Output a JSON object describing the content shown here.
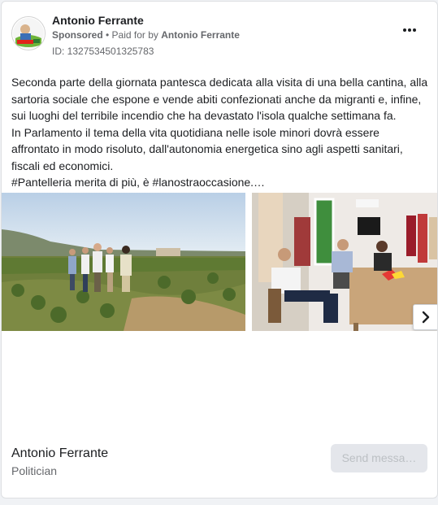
{
  "ad": {
    "page_name": "Antonio Ferrante",
    "sponsored_label": "Sponsored",
    "paid_for_prefix": " • Paid for by ",
    "paid_for_name": "Antonio Ferrante",
    "id_label": "ID: 1327534501325783",
    "more_icon": "more-horizontal-icon",
    "body_lines": [
      "Seconda parte della giornata pantesca dedicata alla visita di una bella cantina, alla sartoria sociale che espone e vende abiti confezionati anche da migranti e, infine, sui luoghi del terribile incendio che ha devastato l'isola qualche settimana fa.",
      "In Parlamento il tema della vita quotidiana nelle isole minori dovrà essere affrontato in modo risoluto, dall'autonomia energetica sino agli aspetti sanitari, fiscali ed economici.",
      "#Pantelleria merita di più, è #lanostraoccasione.…"
    ],
    "carousel": {
      "next_icon": "chevron-right-icon"
    },
    "footer": {
      "name": "Antonio Ferrante",
      "category": "Politician",
      "cta_label": "Send messa…"
    }
  }
}
